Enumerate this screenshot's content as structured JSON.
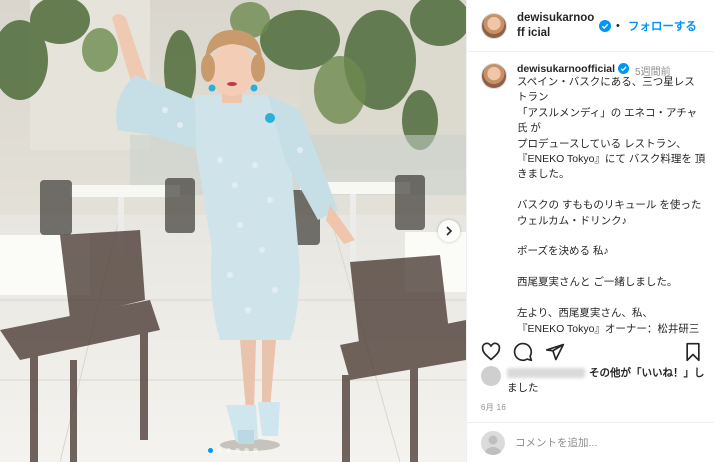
{
  "post": {
    "username": "dewisukarnoofficial",
    "header_username": "dewisukarnooff icial",
    "follow_label": "フォローする",
    "separator": "•",
    "time_ago": "5週間前",
    "caption": "スペイン・バスクにある、三つ星レス\nトラン\n「アスルメンディ」の エネコ・アチャ\n氏 が\nプロデュースしている レストラン、\n『ENEKO Tokyo』にて バスク料理を 頂\nきました。\n\nバスクの すもものリキュール を使った\nウェルカム・ドリンク♪\n\nポーズを決める 私♪\n\n西尾夏実さんと ご一緒しました。\n\n左より、西尾夏実さん、私、\n『ENEKO Tokyo』オーナー：松井研三\nさん。",
    "likes_text": "その他が「いいね！」し",
    "likes_text2": "ました",
    "date": "6月 16",
    "comment_placeholder": "コメントを追加...",
    "carousel_total": 6,
    "carousel_active": 1
  },
  "icons": {
    "verified": "verified-badge-icon",
    "like": "heart-icon",
    "comment": "comment-icon",
    "share": "paper-plane-icon",
    "save": "bookmark-icon",
    "next": "chevron-right-icon"
  },
  "colors": {
    "accent": "#0095f6",
    "muted": "#8e8e8e",
    "text": "#262626"
  }
}
